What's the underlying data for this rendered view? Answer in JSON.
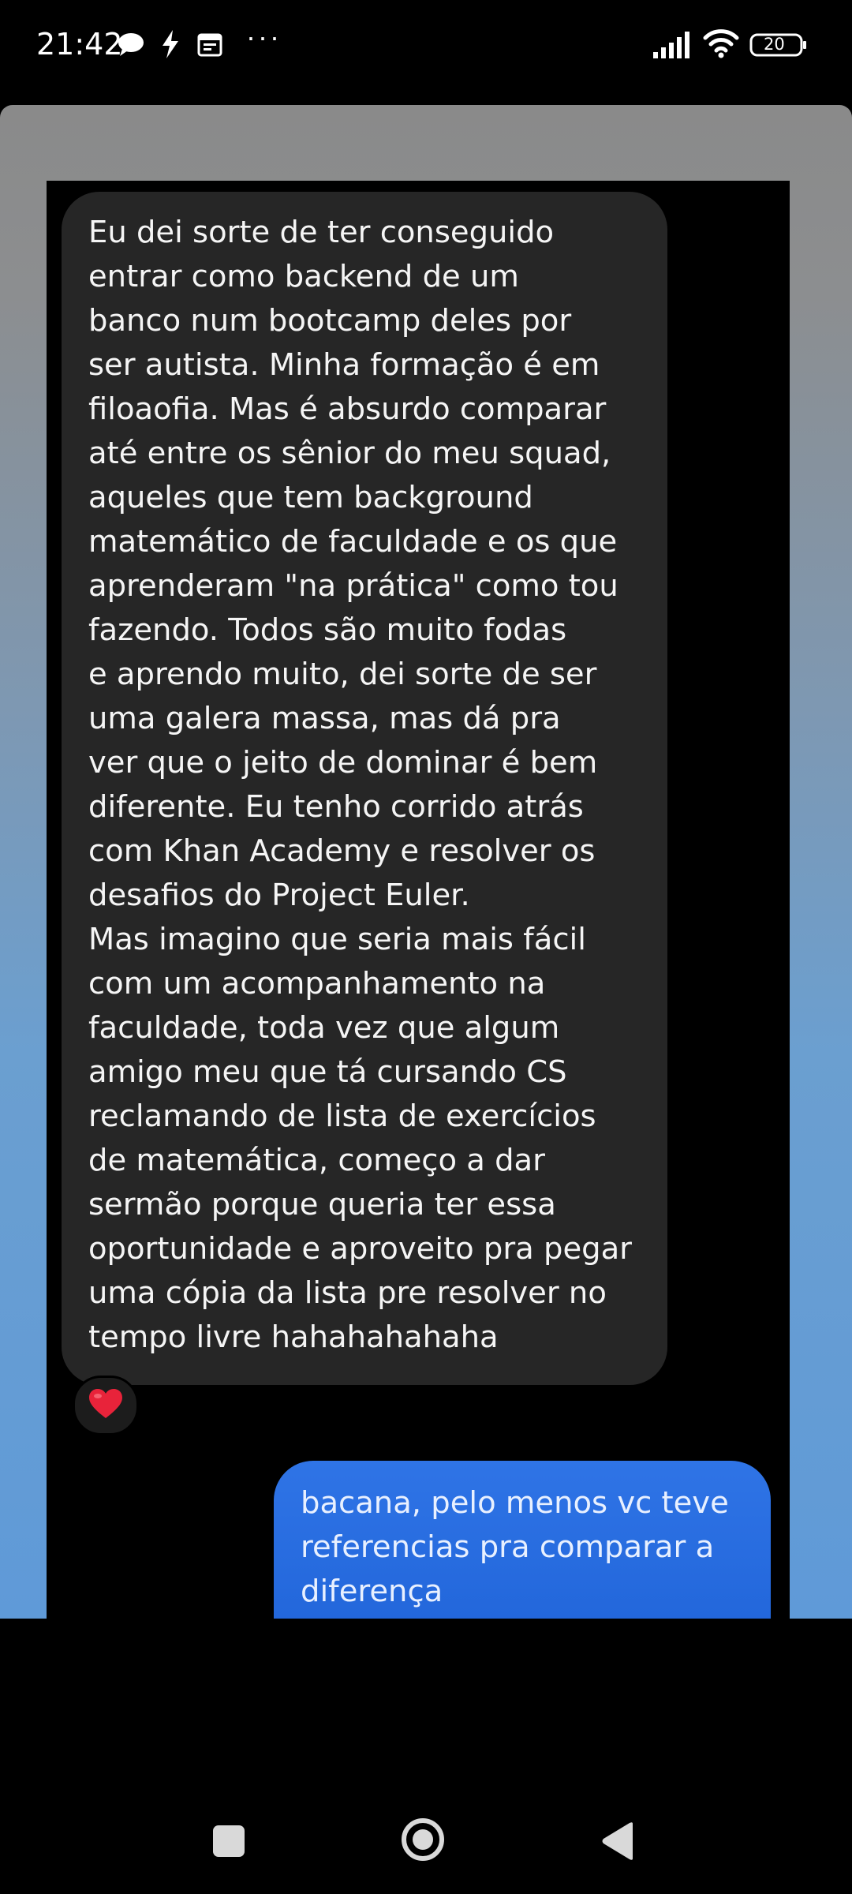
{
  "status_bar": {
    "time": "21:42",
    "notification_icons": [
      "chat-bubble-icon",
      "bolt-icon",
      "calendar-icon"
    ],
    "more": "···",
    "battery": "20"
  },
  "conversation": {
    "received_message": {
      "text": "Eu dei sorte de ter conseguido\nentrar como backend de um\nbanco num bootcamp deles por\nser autista. Minha formação é em\nfiloaofia. Mas é absurdo comparar\naté entre os sênior do meu squad,\naqueles que tem background\nmatemático de faculdade e os que\naprenderam \"na prática\" como tou\nfazendo. Todos são muito fodas\ne aprendo muito, dei sorte de ser\numa galera massa, mas dá pra\nver que o jeito de dominar é bem\ndiferente. Eu tenho corrido atrás\ncom Khan Academy e resolver os\ndesafios do Project Euler.\nMas imagino que seria mais fácil\ncom um acompanhamento na\nfaculdade, toda vez que algum\namigo meu que tá cursando CS\nreclamando de lista de exercícios\nde matemática, começo a dar\nsermão porque queria ter essa\noportunidade e aproveito pra pegar\numa cópia da lista pre resolver no\ntempo livre hahahahahaha",
      "reaction": "heart-icon"
    },
    "sent_message": {
      "text": "bacana, pelo menos vc teve\nreferencias pra comparar a\ndiferença"
    }
  },
  "colors": {
    "received_bubble": "#262626",
    "sent_bubble": "#2f74e6",
    "reaction_heart": "#e8233a"
  },
  "nav_bar": {
    "buttons": [
      "recents-button",
      "home-button",
      "back-button"
    ]
  }
}
